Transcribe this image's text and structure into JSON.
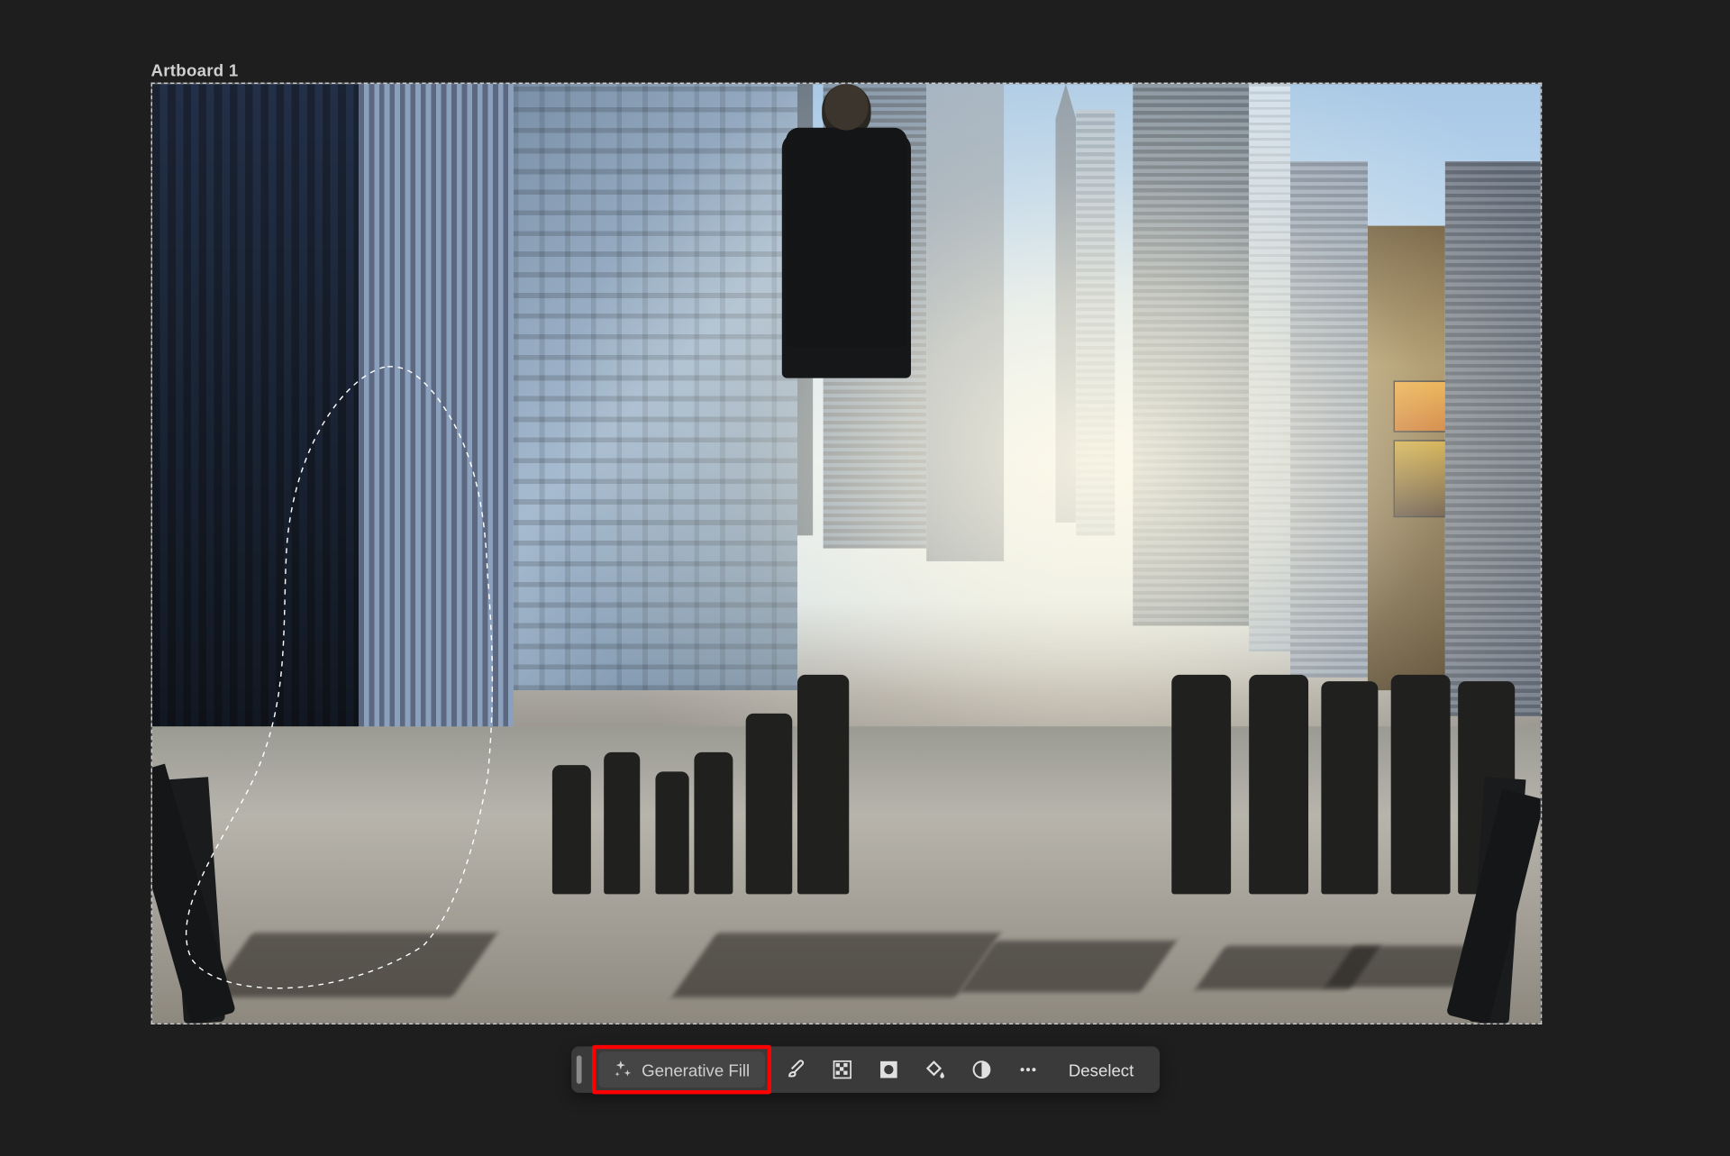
{
  "artboard": {
    "label": "Artboard 1"
  },
  "canvas": {
    "image_description": "Low-angle photo of a busy urban street with crowds of pedestrians walking among tall skyscrapers; strong backlit hazy sunlight",
    "selection": "Freehand lasso around the walking man in the foreground left"
  },
  "taskbar": {
    "generative_fill_label": "Generative Fill",
    "deselect_label": "Deselect",
    "tools": {
      "brush": "brush-icon",
      "remove": "remove-background-icon",
      "mask": "mask-icon",
      "fill": "fill-icon",
      "adjust": "adjust-icon",
      "more": "more-icon"
    }
  },
  "highlight": {
    "target": "generative-fill-button",
    "color": "#ff0000"
  }
}
